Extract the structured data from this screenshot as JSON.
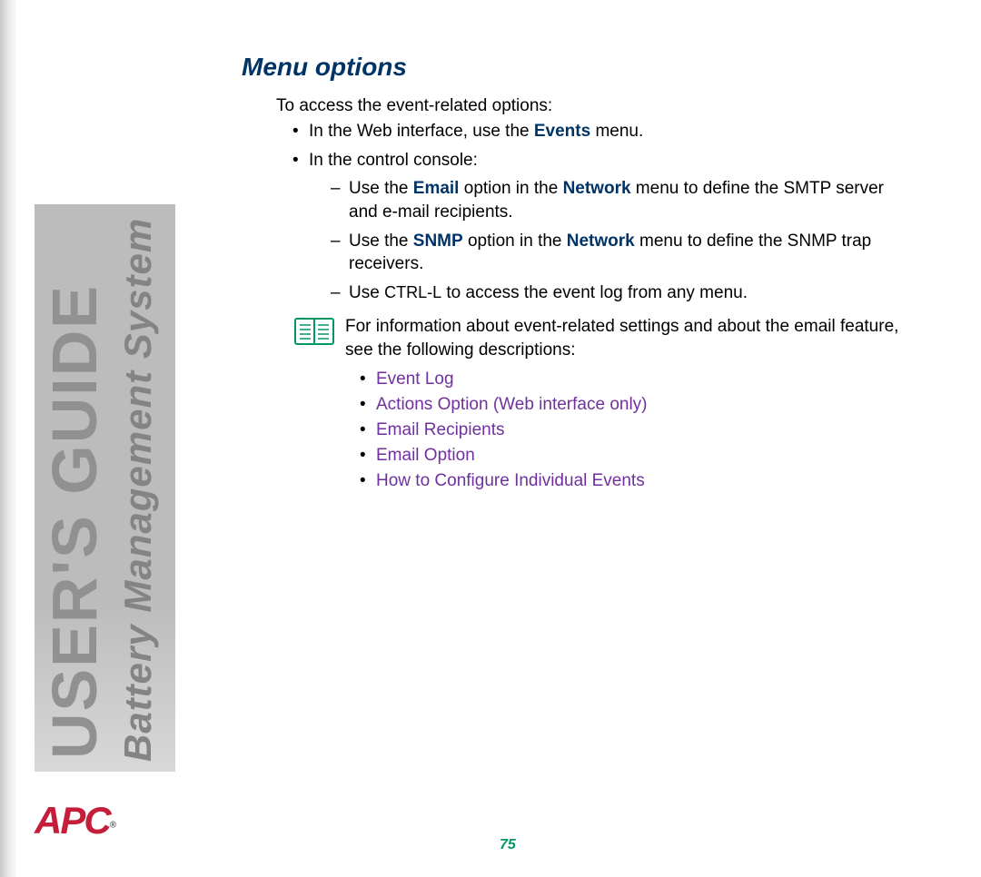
{
  "sidebar": {
    "title_line1": "USER'S GUIDE",
    "title_line2": "Battery Management System"
  },
  "logo": {
    "text": "APC",
    "registered": "®"
  },
  "content": {
    "heading": "Menu options",
    "intro": "To access the event-related options:",
    "bullets": [
      {
        "prefix": "In the Web interface, use the ",
        "bold": "Events",
        "suffix": " menu."
      },
      {
        "text": "In the control console:"
      }
    ],
    "dash_items": [
      {
        "parts": [
          {
            "t": "Use the "
          },
          {
            "t": "Email",
            "bold": true
          },
          {
            "t": " option in the "
          },
          {
            "t": "Network",
            "bold": true
          },
          {
            "t": " menu to define the SMTP server and e-mail recipients."
          }
        ]
      },
      {
        "parts": [
          {
            "t": "Use the "
          },
          {
            "t": "SNMP",
            "bold": true
          },
          {
            "t": " option in the "
          },
          {
            "t": "Network",
            "bold": true
          },
          {
            "t": " menu to define the SNMP trap receivers."
          }
        ]
      },
      {
        "parts": [
          {
            "t": "Use "
          },
          {
            "t": "CTRL-L",
            "smallcaps": true
          },
          {
            "t": " to access the event log from any menu."
          }
        ]
      }
    ],
    "info_text": "For information about event-related settings and about the email feature, see the following descriptions:",
    "links": [
      "Event Log",
      "Actions Option (Web interface only)",
      "Email Recipients",
      "Email Option",
      "How to Configure Individual Events"
    ]
  },
  "page_number": "75"
}
